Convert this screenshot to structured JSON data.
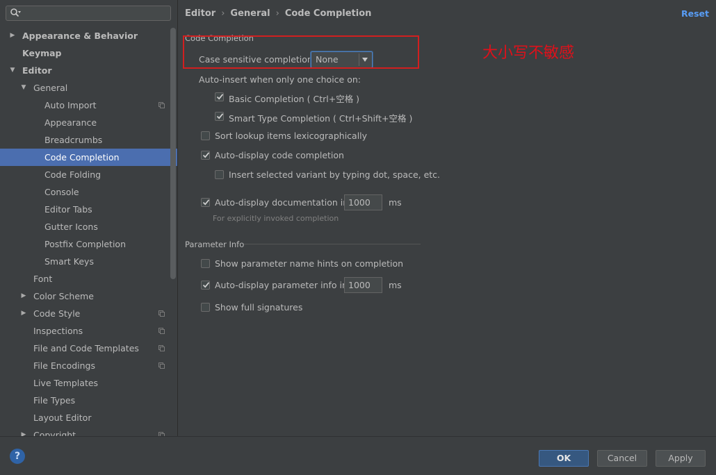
{
  "search": {
    "placeholder": "",
    "value": ""
  },
  "sidebar": {
    "items": [
      {
        "label": "Appearance & Behavior",
        "arrow": "▶"
      },
      {
        "label": "Keymap",
        "arrow": ""
      },
      {
        "label": "Editor",
        "arrow": "▼"
      },
      {
        "label": "General",
        "arrow": "▼"
      },
      {
        "label": "Auto Import",
        "arrow": ""
      },
      {
        "label": "Appearance",
        "arrow": ""
      },
      {
        "label": "Breadcrumbs",
        "arrow": ""
      },
      {
        "label": "Code Completion",
        "arrow": ""
      },
      {
        "label": "Code Folding",
        "arrow": ""
      },
      {
        "label": "Console",
        "arrow": ""
      },
      {
        "label": "Editor Tabs",
        "arrow": ""
      },
      {
        "label": "Gutter Icons",
        "arrow": ""
      },
      {
        "label": "Postfix Completion",
        "arrow": ""
      },
      {
        "label": "Smart Keys",
        "arrow": ""
      },
      {
        "label": "Font",
        "arrow": ""
      },
      {
        "label": "Color Scheme",
        "arrow": "▶"
      },
      {
        "label": "Code Style",
        "arrow": "▶"
      },
      {
        "label": "Inspections",
        "arrow": ""
      },
      {
        "label": "File and Code Templates",
        "arrow": ""
      },
      {
        "label": "File Encodings",
        "arrow": ""
      },
      {
        "label": "Live Templates",
        "arrow": ""
      },
      {
        "label": "File Types",
        "arrow": ""
      },
      {
        "label": "Layout Editor",
        "arrow": ""
      },
      {
        "label": "Copyright",
        "arrow": "▶"
      }
    ]
  },
  "breadcrumb": {
    "part1": "Editor",
    "part2": "General",
    "part3": "Code Completion",
    "separator": "›"
  },
  "reset_label": "Reset",
  "code_completion": {
    "section_title": "Code Completion",
    "case_sensitive_label": "Case sensitive completion:",
    "case_sensitive_value": "None",
    "auto_insert_label": "Auto-insert when only one choice on:",
    "basic_completion": "Basic Completion ( Ctrl+空格 )",
    "smart_type_completion": "Smart Type Completion ( Ctrl+Shift+空格 )",
    "sort_lookup": "Sort lookup items lexicographically",
    "auto_display_completion": "Auto-display code completion",
    "insert_selected_variant": "Insert selected variant by typing dot, space, etc.",
    "auto_display_documentation": "Auto-display documentation in",
    "documentation_delay": "1000",
    "documentation_unit": "ms",
    "documentation_hint": "For explicitly invoked completion"
  },
  "parameter_info": {
    "section_title": "Parameter Info",
    "show_name_hints": "Show parameter name hints on completion",
    "auto_display_param_info": "Auto-display parameter info in",
    "param_delay": "1000",
    "param_unit": "ms",
    "show_full_signatures": "Show full signatures"
  },
  "annotation": {
    "text": "大小写不敏感"
  },
  "buttons": {
    "help": "?",
    "ok": "OK",
    "cancel": "Cancel",
    "apply": "Apply"
  },
  "colors": {
    "background": "#3c3f41",
    "selection": "#4b6eaf",
    "link": "#589df6",
    "annotation": "#e0101a"
  }
}
